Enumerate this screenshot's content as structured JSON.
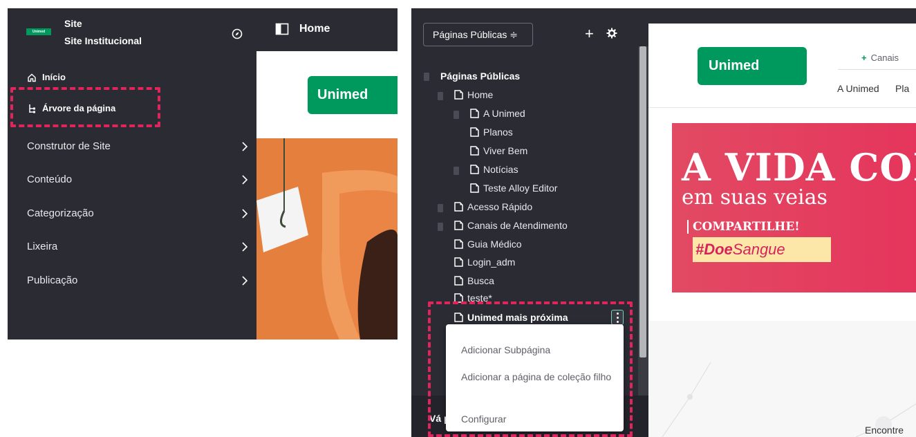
{
  "left_screen": {
    "site": {
      "logo_text": "Unimed",
      "title": "Site",
      "subtitle": "Site Institucional"
    },
    "nav_small": [
      {
        "label": "Início"
      },
      {
        "label": "Árvore da página"
      }
    ],
    "nav_main": [
      {
        "label": "Construtor de Site"
      },
      {
        "label": "Conteúdo"
      },
      {
        "label": "Categorização"
      },
      {
        "label": "Lixeira"
      },
      {
        "label": "Publicação"
      }
    ],
    "topbar": {
      "title": "Home"
    },
    "preview": {
      "logo_text": "Unimed"
    }
  },
  "right_screen": {
    "selector": {
      "label": "Páginas Públicas ≑"
    },
    "tree": [
      {
        "label": "Páginas Públicas"
      },
      {
        "label": "Home"
      },
      {
        "label": "A Unimed"
      },
      {
        "label": "Planos"
      },
      {
        "label": "Viver Bem"
      },
      {
        "label": "Notícias"
      },
      {
        "label": "Teste Alloy Editor"
      },
      {
        "label": "Acesso Rápido"
      },
      {
        "label": "Canais de Atendimento"
      },
      {
        "label": "Guia Médico"
      },
      {
        "label": "Login_adm"
      },
      {
        "label": "Busca"
      },
      {
        "label": "teste*"
      },
      {
        "label": "Unimed mais próxima"
      }
    ],
    "dropdown": [
      {
        "label": "Adicionar Subpágina"
      },
      {
        "label": "Adicionar a página de coleção filho"
      },
      {
        "label": "Configurar"
      }
    ],
    "footer_text": "Vá p",
    "site": {
      "logo_text": "Unimed",
      "canais": "Canais",
      "nav": [
        "A Unimed",
        "Pla"
      ],
      "banner": {
        "title": "A VIDA CORR",
        "subtitle": "em suas veias",
        "share": "COMPARTILHE!",
        "tag_bold": "#Doe",
        "tag_rest": "Sangue"
      },
      "encontre": "Encontre"
    }
  },
  "colors": {
    "sidebar_bg": "#2a2b33",
    "accent_dash": "#e2245c",
    "unimed_green": "#00995d",
    "banner_red": "#e5355c"
  }
}
